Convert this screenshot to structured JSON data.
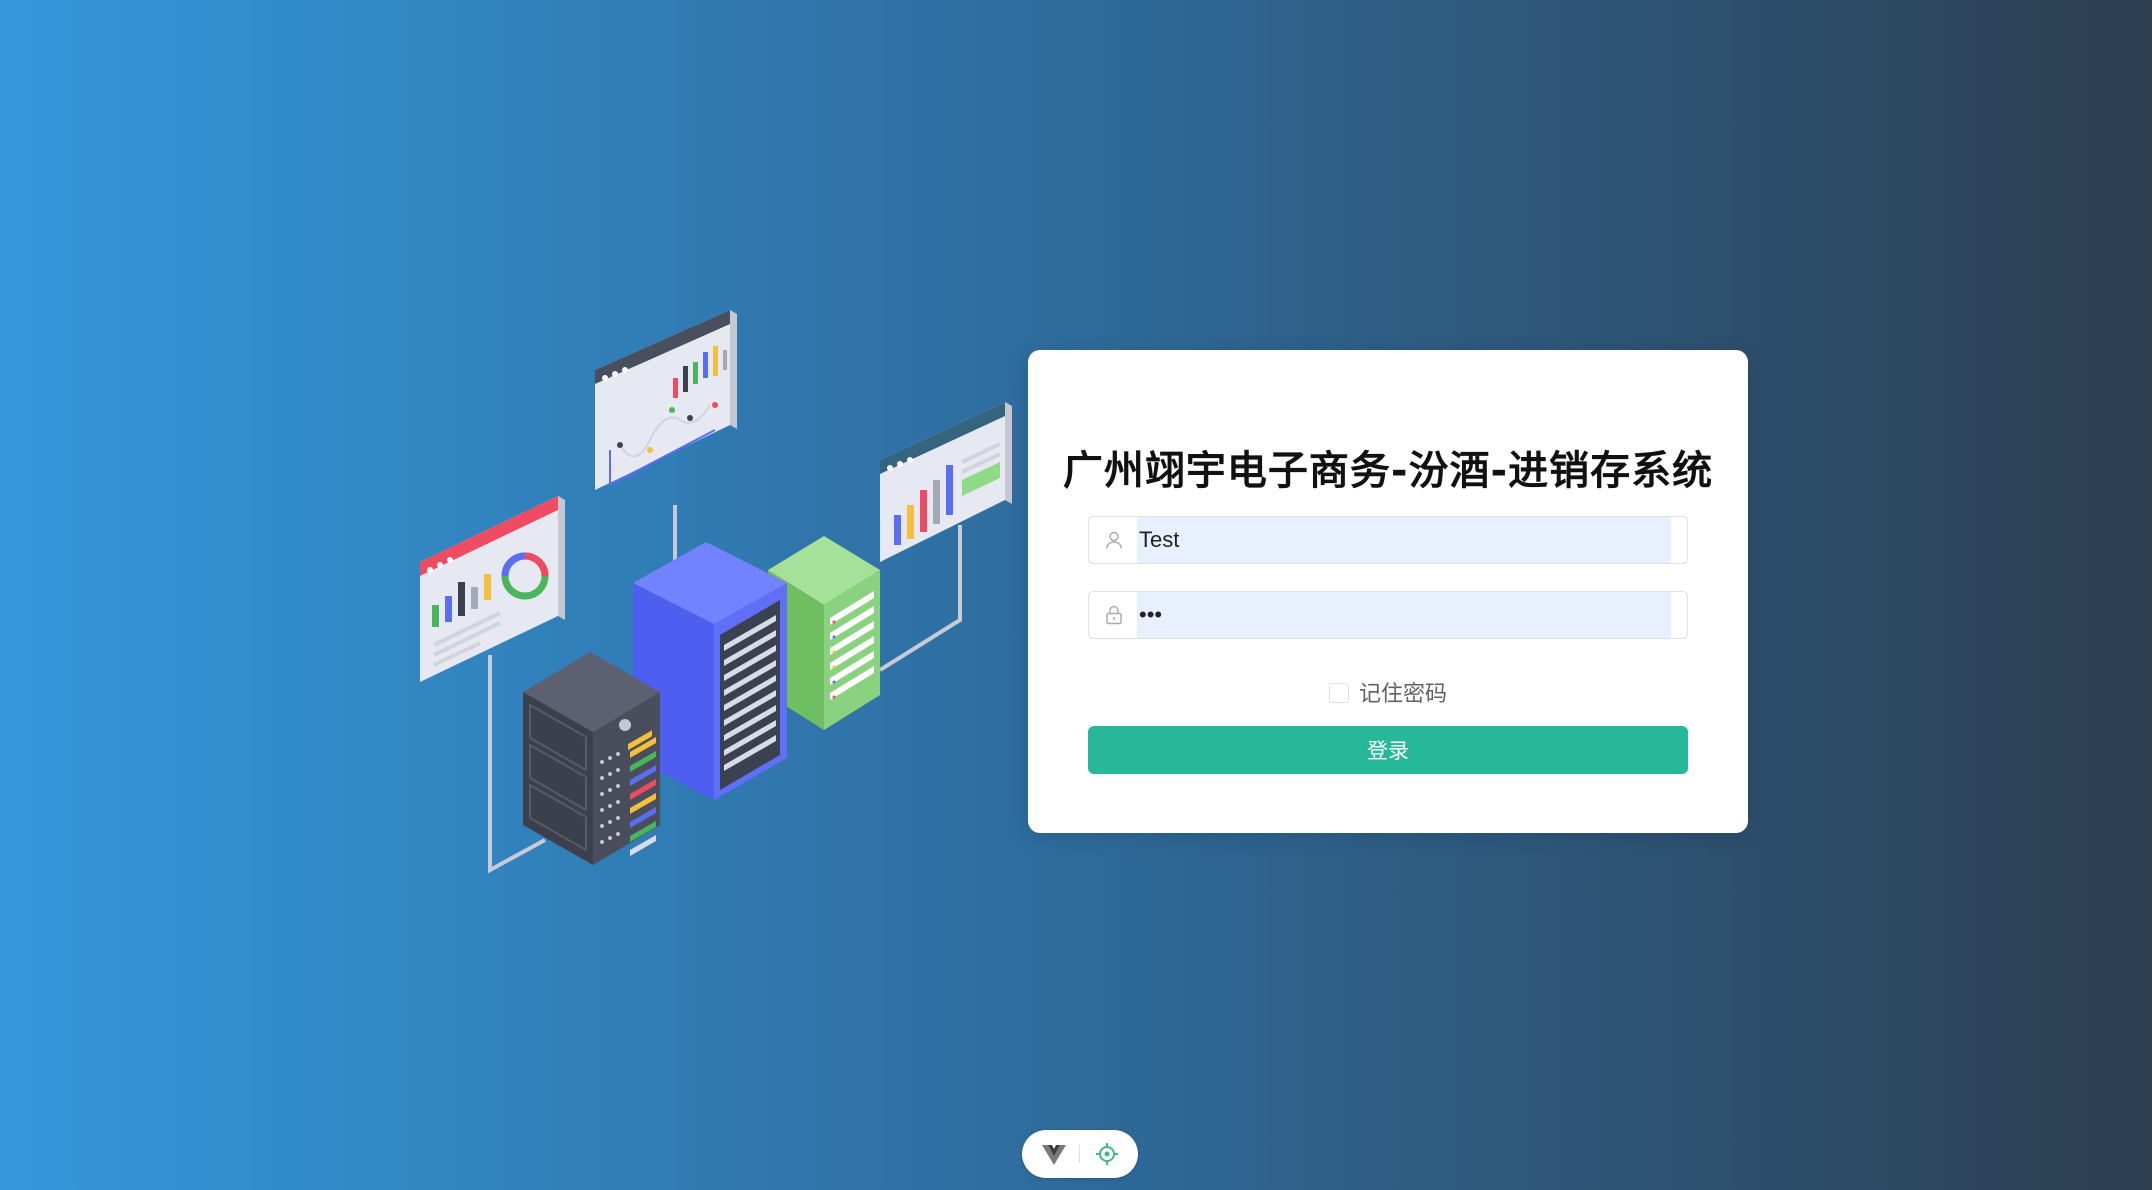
{
  "login": {
    "title": "广州翊宇电子商务-汾酒-进销存系统",
    "username": {
      "value": "Test",
      "icon": "user-icon"
    },
    "password": {
      "value": "•••",
      "icon": "lock-icon"
    },
    "remember_label": "记住密码",
    "remember_checked": false,
    "submit_label": "登录"
  },
  "colors": {
    "background_start": "#3498db",
    "background_end": "#2c3e50",
    "primary_button": "#26b898",
    "input_fill": "#e8f0fe"
  },
  "devtools": {
    "icons": [
      "vue-logo-icon",
      "target-icon"
    ]
  }
}
